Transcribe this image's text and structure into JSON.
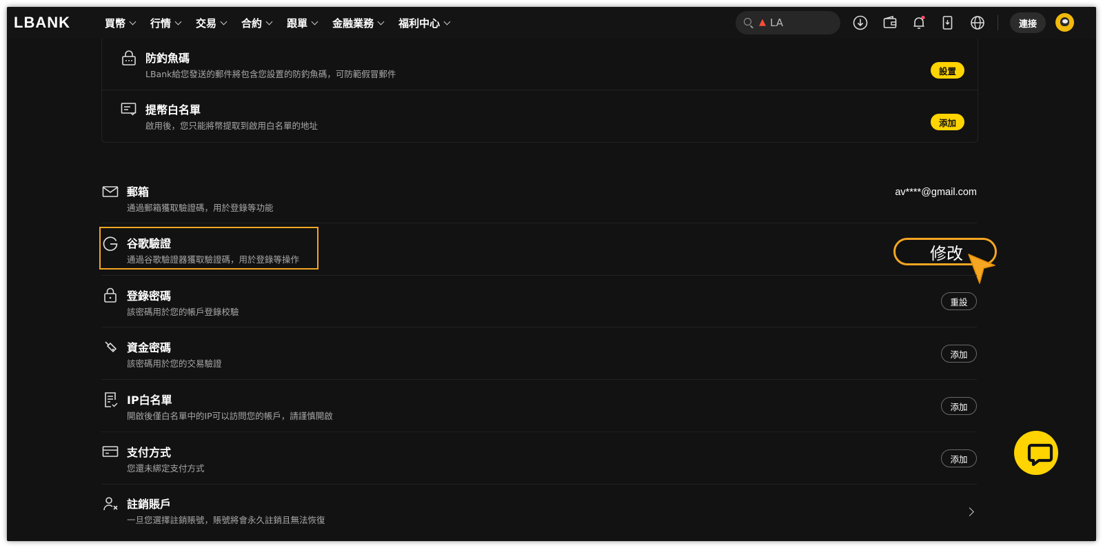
{
  "brand": {
    "logo": "LBANK"
  },
  "nav": {
    "menu": [
      {
        "label": "買幣"
      },
      {
        "label": "行情"
      },
      {
        "label": "交易"
      },
      {
        "label": "合約"
      },
      {
        "label": "跟單"
      },
      {
        "label": "金融業務"
      },
      {
        "label": "福利中心"
      }
    ],
    "search_text": "LA",
    "connect_label": "連接"
  },
  "security_card": {
    "anti_phishing": {
      "title": "防釣魚碼",
      "desc": "LBank給您發送的郵件將包含您設置的防釣魚碼，可防範假冒郵件",
      "button": "設置"
    },
    "withdraw_whitelist": {
      "title": "提幣白名單",
      "desc": "啟用後，您只能將幣提取到啟用白名單的地址",
      "button": "添加"
    }
  },
  "settings": {
    "email": {
      "title": "郵箱",
      "desc": "通過郵箱獲取驗證碼，用於登錄等功能",
      "value": "av****@gmail.com"
    },
    "google_auth": {
      "title": "谷歌驗證",
      "desc": "通過谷歌驗證器獲取驗證碼，用於登錄等操作",
      "button": "修改"
    },
    "login_password": {
      "title": "登錄密碼",
      "desc": "該密碼用於您的帳戶登錄校驗",
      "button": "重設"
    },
    "fund_password": {
      "title": "資金密碼",
      "desc": "該密碼用於您的交易驗證",
      "button": "添加"
    },
    "ip_whitelist": {
      "title": "IP白名單",
      "desc": "開啟後僅白名單中的IP可以訪問您的帳戶，請謹慎開啟",
      "button": "添加"
    },
    "payment_method": {
      "title": "支付方式",
      "desc": "您還未綁定支付方式",
      "button": "添加"
    },
    "delete_account": {
      "title": "註銷賬戶",
      "desc": "一旦您選擇註銷賬號，賬號將會永久註銷且無法恢復"
    }
  },
  "colors": {
    "background": "#121212",
    "accent_yellow": "#ffd400",
    "highlight_orange": "#f5a623",
    "notification_dot": "#ff4d6d"
  },
  "icons": [
    "search-icon",
    "fire-icon",
    "download-icon",
    "wallet-icon",
    "bell-icon",
    "device-icon",
    "globe-icon",
    "avatar",
    "lock-fish-icon",
    "whitelist-card-icon",
    "mail-icon",
    "google-icon",
    "lock-icon",
    "key-icon",
    "document-check-icon",
    "credit-card-icon",
    "user-remove-icon",
    "chevron-right-icon",
    "chat-icon",
    "cursor-pointer-icon"
  ]
}
